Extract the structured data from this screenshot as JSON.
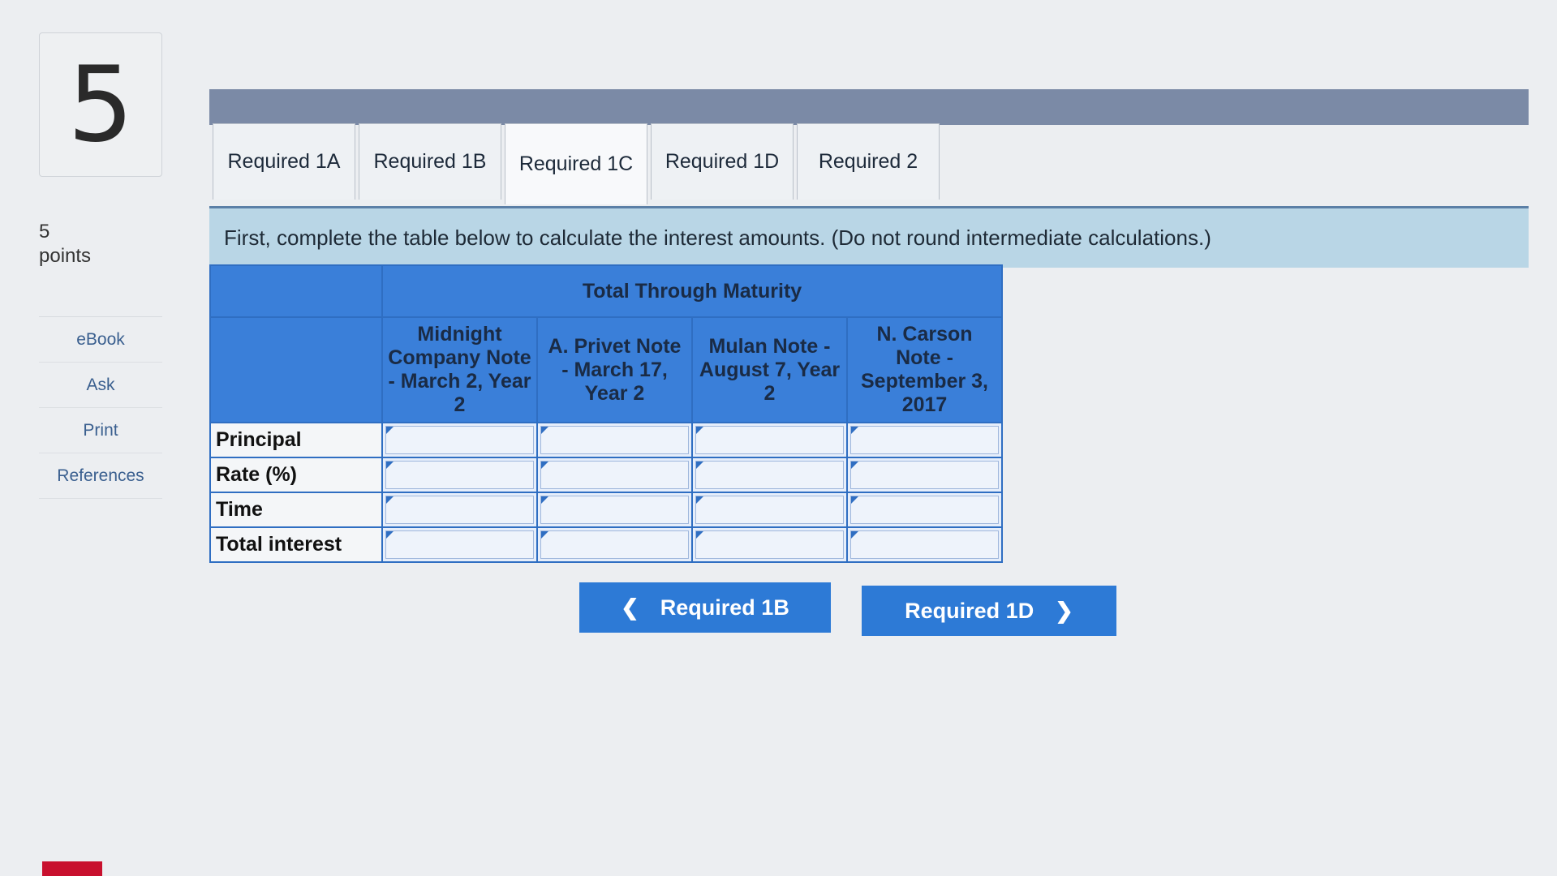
{
  "question": {
    "number": "5",
    "points_value": "5",
    "points_label": "points"
  },
  "side_links": [
    "eBook",
    "Ask",
    "Print",
    "References"
  ],
  "tabs": [
    "Required 1A",
    "Required 1B",
    "Required 1C",
    "Required 1D",
    "Required 2"
  ],
  "active_tab": "Required 1C",
  "instruction": "First, complete the table below to calculate the interest amounts. (Do not round intermediate calculations.)",
  "table": {
    "group_header": "Total Through Maturity",
    "columns": [
      "Midnight Company Note - March 2, Year 2",
      "A. Privet Note - March 17, Year 2",
      "Mulan Note - August 7, Year 2",
      "N. Carson Note - September 3, 2017"
    ],
    "rows": [
      "Principal",
      "Rate (%)",
      "Time",
      "Total interest"
    ]
  },
  "nav": {
    "prev_label": "Required 1B",
    "next_label": "Required 1D"
  },
  "colors": {
    "accent": "#2d7ad6",
    "table_header": "#3a7fd9",
    "banner": "#b9d6e6"
  }
}
